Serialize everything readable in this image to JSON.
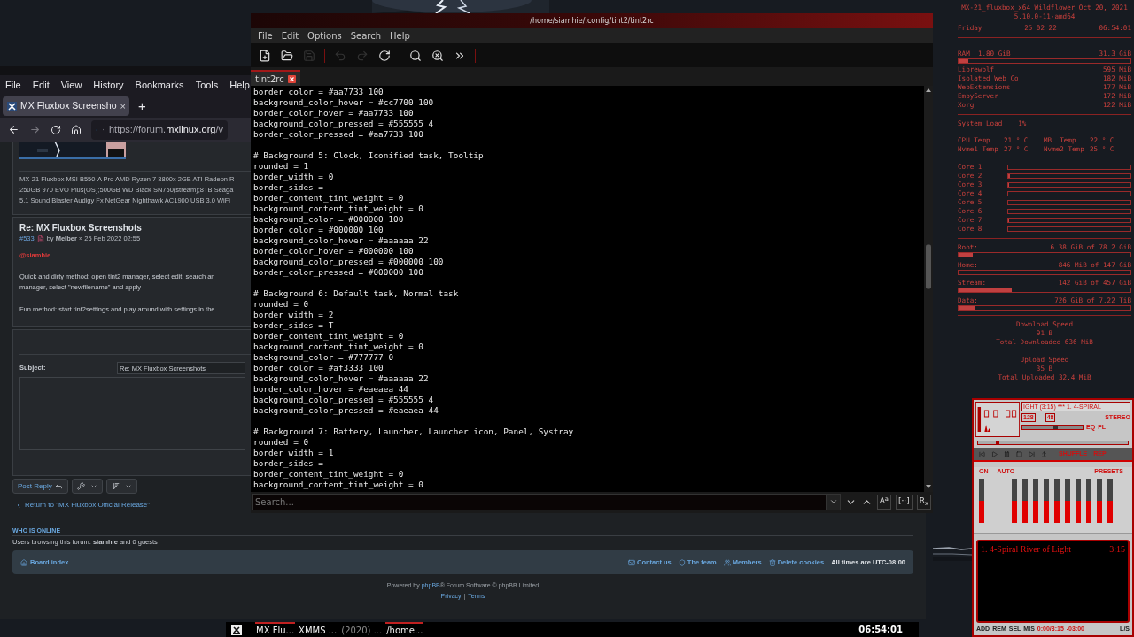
{
  "browser": {
    "menu": [
      "File",
      "Edit",
      "View",
      "History",
      "Bookmarks",
      "Tools",
      "Help"
    ],
    "tab": {
      "title": "MX Fluxbox Screensho",
      "close": "×",
      "selected": true
    },
    "new_tab": "+",
    "url": {
      "prefix": "https://forum.",
      "domain": "mxlinux.org",
      "path": "/v"
    },
    "signature": [
      "MX-21 Fluxbox MSI B550-A Pro AMD Ryzen 7 3800x 2GB ATI Radeon R",
      "250GB 970 EVO Plus(OS);500GB WD Black SN750(stream);8TB Seaga",
      "5.1 Sound Blaster Audigy Fx NetGear Nighthawk AC1900 USB 3.0 WiFi"
    ],
    "post": {
      "title": "Re: MX Fluxbox Screenshots",
      "number": "#533",
      "byline": "by **Melber** » 25 Feb 2022 02:55",
      "mention": "@siamhie",
      "paragraphs": [
        [
          "Quick and dirty method: open tint2 manager, select edit, search an",
          "manager, select \"newfilename\" and apply"
        ],
        [
          "Fun method: start tint2settings and play around with settings in the"
        ]
      ]
    },
    "reply": {
      "subject_label": "Subject:",
      "subject_value": "Re: MX Fluxbox Screenshots"
    },
    "post_reply": "Post Reply",
    "return_link": "Return to \"MX Fluxbox Official Release\"",
    "who_is_online": {
      "heading": "WHO IS ONLINE",
      "text": "Users browsing this forum: **siamhie** and 0 guests"
    },
    "footer": {
      "board_index": "Board index",
      "links": [
        {
          "kind": "contact",
          "label": "Contact us"
        },
        {
          "kind": "team",
          "label": "The team"
        },
        {
          "kind": "members",
          "label": "Members"
        },
        {
          "kind": "cookies",
          "label": "Delete cookies"
        }
      ],
      "timezone": "All times are UTC-08:00",
      "powered_before": "Powered by ",
      "phpbb": "phpBB",
      "powered_after": "® Forum Software © phpBB Limited",
      "privacy": "Privacy",
      "separator": "|",
      "terms": "Terms"
    }
  },
  "editor": {
    "title": "/home/siamhie/.config/tint2/tint2rc",
    "menu": [
      "File",
      "Edit",
      "Options",
      "Search",
      "Help"
    ],
    "toolbar": [
      {
        "kind": "new",
        "disabled": false
      },
      {
        "kind": "open",
        "disabled": false
      },
      {
        "kind": "save",
        "disabled": true
      },
      {
        "kind": "sep"
      },
      {
        "kind": "undo",
        "disabled": true
      },
      {
        "kind": "redo",
        "disabled": true
      },
      {
        "kind": "reload",
        "disabled": false
      },
      {
        "kind": "sep"
      },
      {
        "kind": "find",
        "disabled": false
      },
      {
        "kind": "clear",
        "disabled": false
      },
      {
        "kind": "more",
        "disabled": false
      },
      {
        "kind": "sep"
      }
    ],
    "tab": {
      "label": "tint2rc",
      "selected": true
    },
    "code_blocks": [
      [
        "border_color = #aa7733 100",
        "background_color_hover = #cc7700 100",
        "border_color_hover = #aa7733 100",
        "background_color_pressed = #555555 4",
        "border_color_pressed = #aa7733 100"
      ],
      [
        "# Background 5: Clock, Iconified task, Tooltip",
        "rounded = 1",
        "border_width = 0",
        "border_sides =",
        "border_content_tint_weight = 0",
        "background_content_tint_weight = 0",
        "background_color = #000000 100",
        "border_color = #000000 100",
        "background_color_hover = #aaaaaa 22",
        "border_color_hover = #000000 100",
        "background_color_pressed = #000000 100",
        "border_color_pressed = #000000 100"
      ],
      [
        "# Background 6: Default task, Normal task",
        "rounded = 0",
        "border_width = 2",
        "border_sides = T",
        "border_content_tint_weight = 0",
        "background_content_tint_weight = 0",
        "background_color = #777777 0",
        "border_color = #af3333 100",
        "background_color_hover = #aaaaaa 22",
        "border_color_hover = #eaeaea 44",
        "background_color_pressed = #555555 4",
        "background_color_pressed = #eaeaea 44"
      ],
      [
        "# Background 7: Battery, Launcher, Launcher icon, Panel, Systray",
        "rounded = 0",
        "border_width = 1",
        "border_sides =",
        "border_content_tint_weight = 0",
        "background_content_tint_weight = 0"
      ]
    ],
    "search_placeholder": "Search...",
    "search_toggles": [
      {
        "label": "A$^{a}$",
        "on": false
      },
      {
        "label": "[··]",
        "on": false
      },
      {
        "label": "R$_{x}$",
        "on": false
      }
    ]
  },
  "conky": {
    "header": "MX-21_fluxbox_x64 Wildflower Oct 20, 2021",
    "kernel": "5.10.0-11-amd64",
    "day": "Friday",
    "date": "25 02 22",
    "time": "06:54:01",
    "ram": {
      "label": "RAM",
      "used": "1.80 GiB",
      "total": "31.3 GiB",
      "level": 0.055
    },
    "processes": [
      {
        "name": "Librewolf",
        "mem": "595 MiB"
      },
      {
        "name": "Isolated Web Co",
        "mem": "182 MiB"
      },
      {
        "name": "WebExtensions",
        "mem": "177 MiB"
      },
      {
        "name": "EmbyServer",
        "mem": "172 MiB"
      },
      {
        "name": "Xorg",
        "mem": "122 MiB"
      }
    ],
    "load": {
      "label": "System Load",
      "value": "1%"
    },
    "temps": [
      {
        "label": "CPU Temp",
        "value": "21 ° C"
      },
      {
        "label": "MB  Temp",
        "value": "22 ° C"
      },
      {
        "label": "Nvme1 Temp",
        "value": "27 ° C"
      },
      {
        "label": "Nvme2 Temp",
        "value": "25 ° C"
      }
    ],
    "cores": [
      {
        "label": "Core 1",
        "level": 0
      },
      {
        "label": "Core 2",
        "level": 0.015
      },
      {
        "label": "Core 3",
        "level": 0.008
      },
      {
        "label": "Core 4",
        "level": 0
      },
      {
        "label": "Core 5",
        "level": 0
      },
      {
        "label": "Core 6",
        "level": 0
      },
      {
        "label": "Core 7",
        "level": 0.005
      },
      {
        "label": "Core 8",
        "level": 0
      }
    ],
    "disks": [
      {
        "label": "Root:",
        "usage": "6.38 GiB of 78.2 GiB",
        "level": 0.08
      },
      {
        "label": "Home:",
        "usage": "846 MiB of 147 GiB",
        "level": 0.006
      },
      {
        "label": "Stream:",
        "usage": "142 GiB of 457 GiB",
        "level": 0.31
      },
      {
        "label": "Data:",
        "usage": "726 GiB of 7.22 TiB",
        "level": 0.1
      }
    ],
    "network": [
      {
        "title": "Download Speed",
        "speed": "91 B",
        "total": "Total Downloaded 636 MiB"
      },
      {
        "title": "Upload Speed",
        "speed": "35 B",
        "total": "Total Uploaded 32.4 MiB"
      }
    ]
  },
  "xmms": {
    "marquee": "IGHT (3:15) *** 1. 4-SPIRAL",
    "bitrate": "128",
    "samplerate": "48",
    "stereo": "STEREO",
    "volume": {
      "level": 0.55
    },
    "seek": {
      "level": 0.12
    },
    "eq": "EQ",
    "pl": "PL",
    "shuffle": "SHUFFLE",
    "rep": "REP",
    "eq_on": "ON",
    "eq_auto": "AUTO",
    "presets": "PRESETS",
    "eq_bands": [
      {
        "level": 0.5
      },
      {
        "level": 0.5
      },
      {
        "level": 0.5
      },
      {
        "level": 0.5
      },
      {
        "level": 0.5
      },
      {
        "level": 0.5
      },
      {
        "level": 0.5
      },
      {
        "level": 0.5
      },
      {
        "level": 0.5
      },
      {
        "level": 0.5
      },
      {
        "level": 0.5
      }
    ],
    "playlist": [
      {
        "title": "1. 4-Spiral River of Light",
        "duration": "3:15"
      }
    ],
    "playlist_buttons": [
      "ADD",
      "REM",
      "SEL",
      "MIS"
    ],
    "position": "0:00/3:15",
    "remaining": "-03:00",
    "list_options": "L/S"
  },
  "taskbar": {
    "tasks": [
      {
        "label": "MX Flu...",
        "selected": true,
        "iconified": false
      },
      {
        "label": "XMMS ...",
        "selected": false,
        "iconified": false
      },
      {
        "label": "(2020) ...",
        "selected": false,
        "iconified": true
      },
      {
        "label": "/home...",
        "selected": true,
        "iconified": false
      }
    ],
    "clock": "06:54:01"
  }
}
